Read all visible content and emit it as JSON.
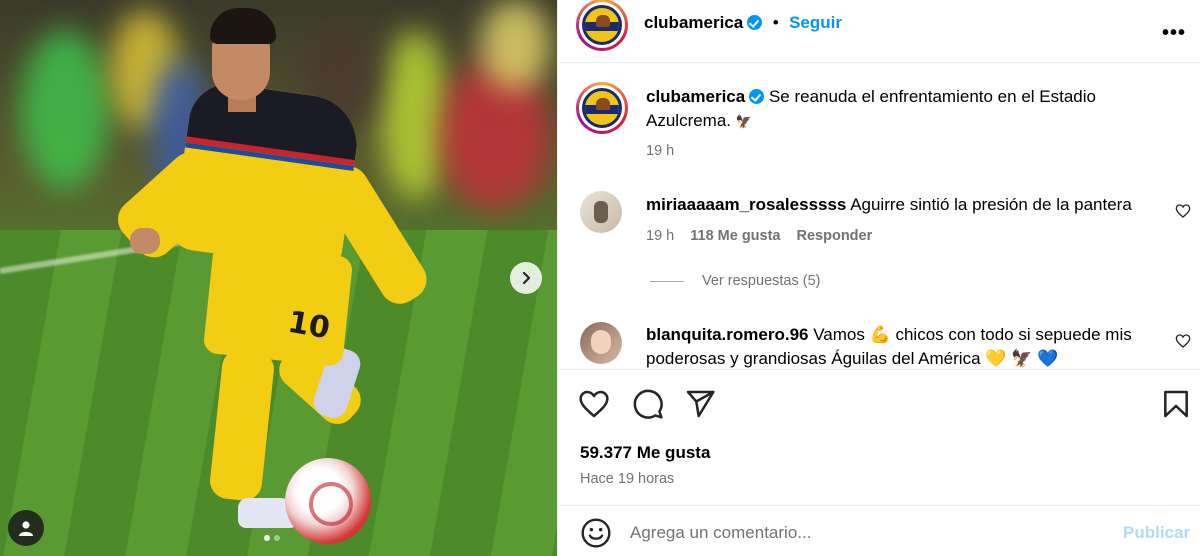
{
  "post": {
    "account": "clubamerica",
    "follow_label": "Seguir",
    "caption": "Se reanuda el enfrentamiento en el Estadio Azulcrema.",
    "caption_time": "19 h",
    "media_jersey_number": "10"
  },
  "comments": [
    {
      "username": "miriaaaaam_rosalesssss",
      "text": "Aguirre sintió la presión de la pantera",
      "time": "19 h",
      "likes": "118 Me gusta",
      "reply_label": "Responder",
      "view_replies": "Ver respuestas (5)"
    },
    {
      "username": "blanquita.romero.96",
      "text": "Vamos 💪 chicos con todo si sepuede mis poderosas y grandiosas Águilas del América 💛 🦅 💙"
    }
  ],
  "actions": {
    "likes": "59.377 Me gusta",
    "posted": "Hace 19 horas",
    "comment_placeholder": "Agrega un comentario...",
    "publish_label": "Publicar"
  },
  "icons": {
    "like": "heart-icon",
    "comment": "comment-icon",
    "share": "share-icon",
    "save": "bookmark-icon",
    "emoji": "emoji-icon",
    "more": "more-icon",
    "next": "chevron-right-icon",
    "tags": "user-tag-icon"
  },
  "colors": {
    "accent": "#0095f6",
    "muted": "#737373",
    "publish_disabled": "#b3dbff",
    "jersey_yellow": "#f3cd14"
  },
  "carousel": {
    "total": 2,
    "current": 1
  }
}
